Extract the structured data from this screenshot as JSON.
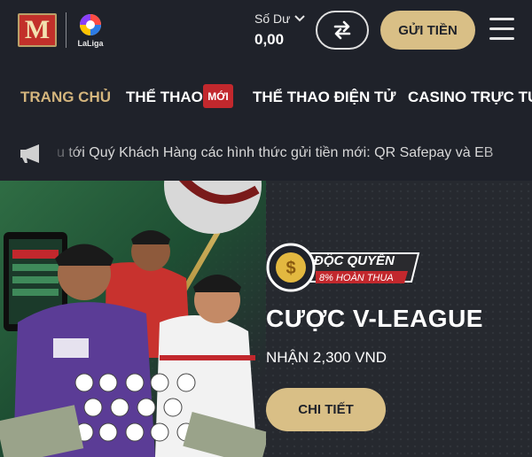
{
  "header": {
    "logo_letter": "M",
    "partner_logo_text": "LaLiga",
    "balance_label": "Số Dư",
    "balance_value": "0,00",
    "deposit_label": "GỬI TIỀN",
    "icons": [
      "m-logo",
      "laliga-logo",
      "chevron-down-icon",
      "swap-icon",
      "hamburger-menu-icon"
    ]
  },
  "nav": {
    "items": [
      {
        "label": "TRANG CHỦ",
        "active": true
      },
      {
        "label": "THỂ THAO",
        "badge": "MỚI"
      },
      {
        "label": "THỂ THAO ĐIỆN TỬ"
      },
      {
        "label": "CASINO TRỰC TUYẾN"
      }
    ]
  },
  "ticker": {
    "icon": "megaphone-icon",
    "text": "u tới Quý Khách Hàng các hình thức gửi tiền mới: QR Safepay và EB"
  },
  "banner": {
    "badge_title": "ĐỘC QUYỀN",
    "badge_subtitle": "8% HOÀN THUA",
    "title": "CƯỢC V-LEAGUE",
    "subtitle": "NHẬN 2,300 VND",
    "cta_label": "CHI TIẾT",
    "colors": {
      "gold": "#d9bf86",
      "dark": "#1f222a",
      "red": "#c2282d",
      "green": "#2f6d44"
    }
  }
}
